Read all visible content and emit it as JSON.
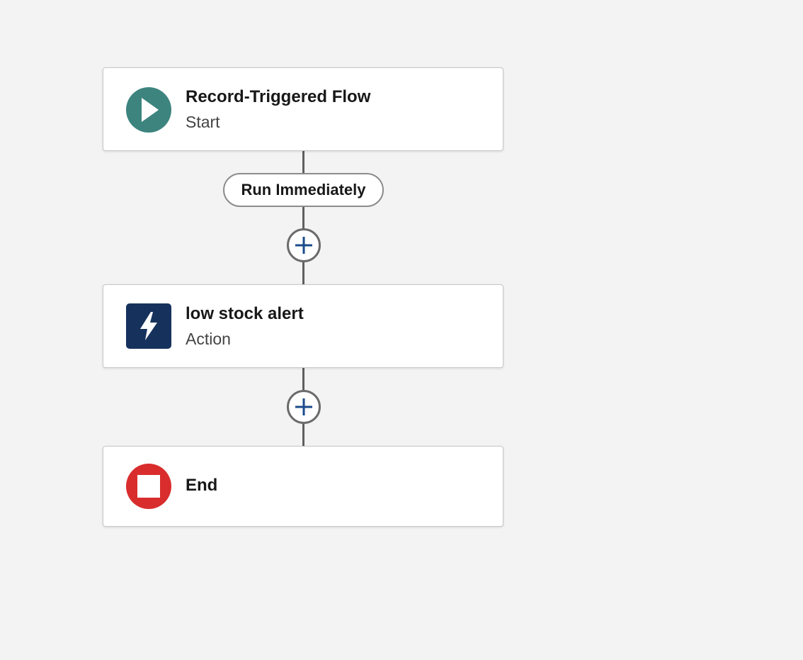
{
  "flow": {
    "start": {
      "title": "Record-Triggered Flow",
      "subtitle": "Start",
      "icon": "play-icon",
      "icon_color": "#3d847f"
    },
    "path": {
      "label": "Run Immediately"
    },
    "action": {
      "title": "low stock alert",
      "subtitle": "Action",
      "icon": "lightning-bolt-icon",
      "icon_color": "#16325c"
    },
    "end": {
      "title": "End",
      "icon": "stop-icon",
      "icon_color": "#d92d2d"
    },
    "add_buttons": [
      {
        "icon": "plus-icon",
        "color": "#1b4b8a"
      },
      {
        "icon": "plus-icon",
        "color": "#1b4b8a"
      }
    ]
  }
}
